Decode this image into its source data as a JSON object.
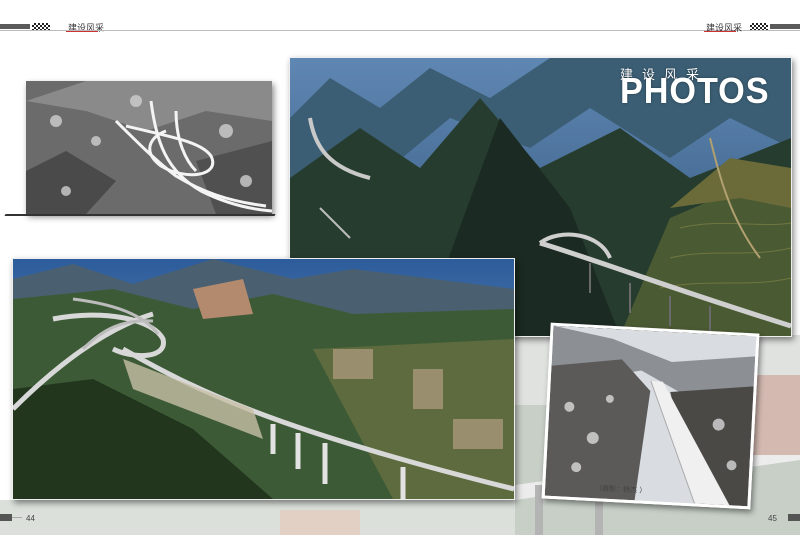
{
  "header": {
    "left_title": "建设风采",
    "right_title": "建设风采"
  },
  "banner": {
    "cn_title": "建设风采",
    "en_title": "PHOTOS"
  },
  "photos": [
    {
      "name": "snowy-interchange-photo"
    },
    {
      "name": "mountain-highway-aerial-photo"
    },
    {
      "name": "viaduct-interchange-aerial-photo"
    },
    {
      "name": "snowy-bridge-photo"
    }
  ],
  "caption": "（摄影：杨杰 ）",
  "footer": {
    "left_page": "44",
    "right_page": "45"
  },
  "colors": {
    "header_bar": "#5a5a5a",
    "mountain_green": "#2c4a3a",
    "sky_blue": "#3a6ea0"
  }
}
